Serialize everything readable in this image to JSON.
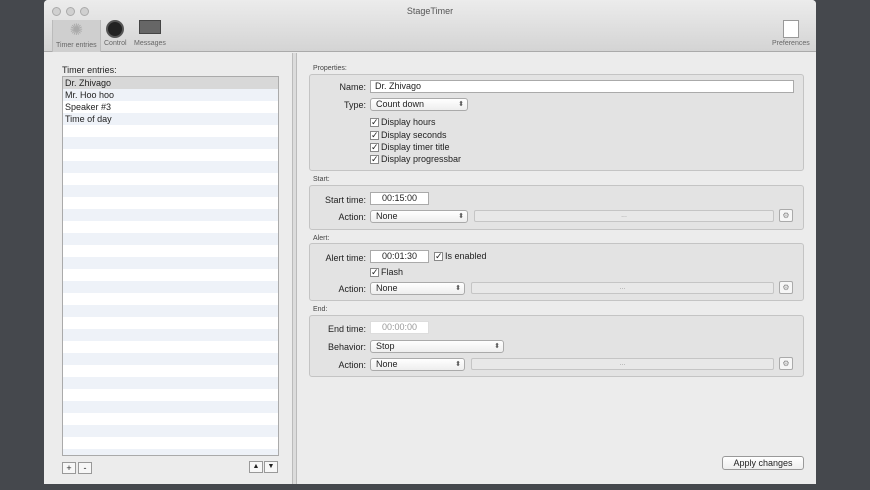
{
  "window": {
    "title": "StageTimer"
  },
  "toolbar": {
    "timer_entries": "Timer entries",
    "control": "Control",
    "messages": "Messages",
    "preferences": "Preferences"
  },
  "left": {
    "label": "Timer entries:",
    "items": [
      "Dr. Zhivago",
      "Mr. Hoo hoo",
      "Speaker #3",
      "Time of day"
    ],
    "add": "+",
    "remove": "-",
    "up": "▲",
    "down": "▼"
  },
  "properties": {
    "label": "Properties:",
    "name_label": "Name:",
    "name_value": "Dr. Zhivago",
    "type_label": "Type:",
    "type_value": "Count down",
    "display_hours": "Display hours",
    "display_seconds": "Display seconds",
    "display_title": "Display timer title",
    "display_progressbar": "Display progressbar"
  },
  "start": {
    "label": "Start:",
    "time_label": "Start time:",
    "time_value": "00:15:00",
    "action_label": "Action:",
    "action_value": "None",
    "action_field": "..."
  },
  "alert": {
    "label": "Alert:",
    "time_label": "Alert time:",
    "time_value": "00:01:30",
    "enabled": "Is enabled",
    "flash": "Flash",
    "action_label": "Action:",
    "action_value": "None",
    "action_field": "..."
  },
  "end": {
    "label": "End:",
    "time_label": "End time:",
    "time_value": "00:00:00",
    "behavior_label": "Behavior:",
    "behavior_value": "Stop",
    "action_label": "Action:",
    "action_value": "None",
    "action_field": "..."
  },
  "apply": "Apply changes",
  "check": "✓"
}
